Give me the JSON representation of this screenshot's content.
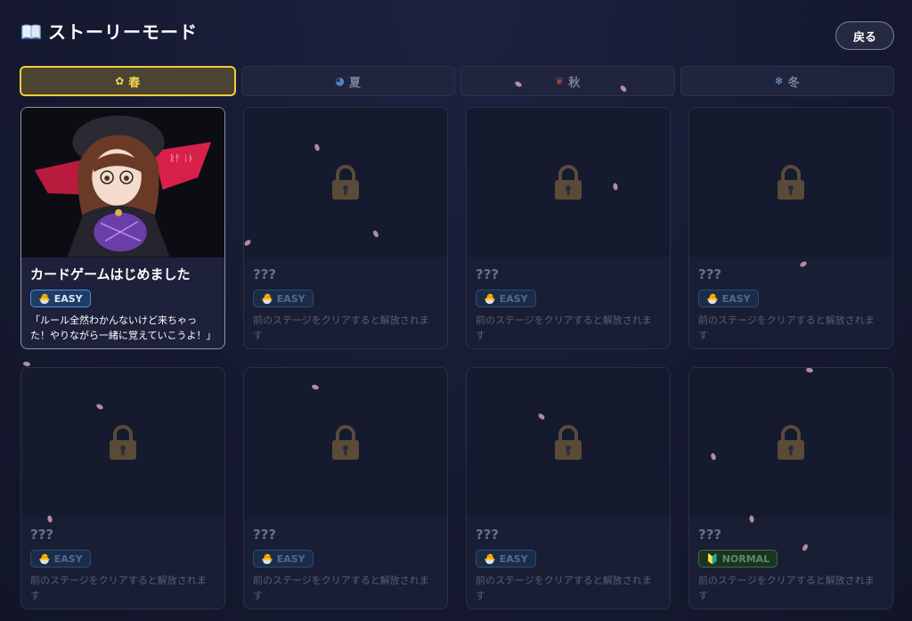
{
  "header": {
    "title": "ストーリーモード",
    "icon": "book-icon",
    "back_label": "戻る"
  },
  "tabs": [
    {
      "label": "春",
      "icon": "sakura-icon",
      "active": true
    },
    {
      "label": "夏",
      "icon": "wave-icon",
      "active": false
    },
    {
      "label": "秋",
      "icon": "leaf-icon",
      "active": false
    },
    {
      "label": "冬",
      "icon": "snowflake-icon",
      "active": false
    }
  ],
  "stages": [
    {
      "title": "カードゲームはじめました",
      "difficulty": "EASY",
      "desc": "「ルール全然わかんないけど来ちゃった！やりながら一緒に覚えていこうよ！」",
      "locked": false
    },
    {
      "title": "???",
      "difficulty": "EASY",
      "desc": "前のステージをクリアすると解放されます",
      "locked": true
    },
    {
      "title": "???",
      "difficulty": "EASY",
      "desc": "前のステージをクリアすると解放されます",
      "locked": true
    },
    {
      "title": "???",
      "difficulty": "EASY",
      "desc": "前のステージをクリアすると解放されます",
      "locked": true
    },
    {
      "title": "???",
      "difficulty": "EASY",
      "desc": "前のステージをクリアすると解放されます",
      "locked": true
    },
    {
      "title": "???",
      "difficulty": "EASY",
      "desc": "前のステージをクリアすると解放されます",
      "locked": true
    },
    {
      "title": "???",
      "difficulty": "EASY",
      "desc": "前のステージをクリアすると解放されます",
      "locked": true
    },
    {
      "title": "???",
      "difficulty": "NORMAL",
      "desc": "前のステージをクリアすると解放されます",
      "locked": true
    }
  ],
  "colors": {
    "accent": "#f1cc3c",
    "easy": "#4b8fe0",
    "normal": "#3b6b41",
    "petal": "#e7b3c2"
  }
}
